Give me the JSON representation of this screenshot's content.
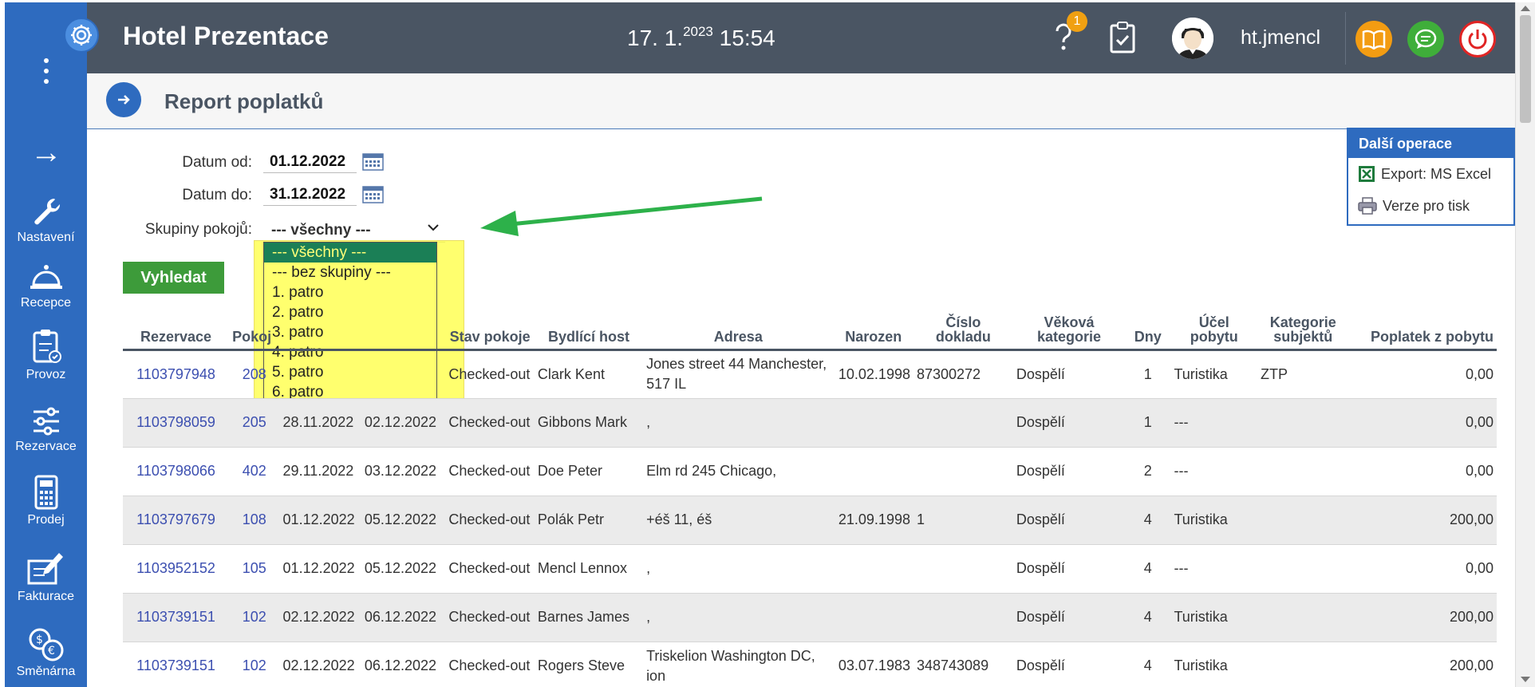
{
  "header": {
    "app_title": "Hotel Prezentace",
    "clock_day": "17. 1.",
    "clock_year": "2023",
    "clock_time": "15:54",
    "help_badge": "1",
    "username": "ht.jmencl"
  },
  "sidebar": {
    "items": [
      {
        "label": "Nastavení",
        "icon": "wrench-icon"
      },
      {
        "label": "Recepce",
        "icon": "bell-icon"
      },
      {
        "label": "Provoz",
        "icon": "clipboard-icon"
      },
      {
        "label": "Rezervace",
        "icon": "sliders-icon"
      },
      {
        "label": "Prodej",
        "icon": "calculator-icon"
      },
      {
        "label": "Fakturace",
        "icon": "invoice-icon"
      },
      {
        "label": "Směnárna",
        "icon": "exchange-icon"
      }
    ]
  },
  "page": {
    "title": "Report poplatků"
  },
  "filters": {
    "date_from_label": "Datum od:",
    "date_from": "01.12.2022",
    "date_to_label": "Datum do:",
    "date_to": "31.12.2022",
    "groups_label": "Skupiny pokojů:",
    "groups_selected": "--- všechny ---",
    "groups_options": [
      "--- všechny ---",
      "--- bez skupiny ---",
      "1. patro",
      "2. patro",
      "3. patro",
      "4. patro",
      "5. patro",
      "6. patro"
    ],
    "search_label": "Vyhledat"
  },
  "ops": {
    "title": "Další operace",
    "export_label": "Export: MS Excel",
    "print_label": "Verze pro tisk"
  },
  "table": {
    "headers": {
      "rez": "Rezervace",
      "pokoj": "Pokoj",
      "od": "",
      "do": "",
      "stav": "Stav pokoje",
      "host": "Bydlící host",
      "adresa": "Adresa",
      "narozen": "Narozen",
      "doklad": "Číslo dokladu",
      "vek": "Věková kategorie",
      "dny": "Dny",
      "ucel": "Účel pobytu",
      "kat": "Kategorie subjektů",
      "poplatek": "Poplatek z pobytu"
    },
    "rows": [
      {
        "rez": "1103797948",
        "pokoj": "208",
        "od": "",
        "do": "",
        "stav": "Checked-out",
        "host": "Clark Kent",
        "adresa": "Jones street 44 Manchester, 517 IL",
        "narozen": "10.02.1998",
        "doklad": "87300272",
        "vek": "Dospělí",
        "dny": "1",
        "ucel": "Turistika",
        "kat": "ZTP",
        "poplatek": "0,00"
      },
      {
        "rez": "1103798059",
        "pokoj": "205",
        "od": "28.11.2022",
        "do": "02.12.2022",
        "stav": "Checked-out",
        "host": "Gibbons Mark",
        "adresa": ",",
        "narozen": "",
        "doklad": "",
        "vek": "Dospělí",
        "dny": "1",
        "ucel": "---",
        "kat": "",
        "poplatek": "0,00"
      },
      {
        "rez": "1103798066",
        "pokoj": "402",
        "od": "29.11.2022",
        "do": "03.12.2022",
        "stav": "Checked-out",
        "host": "Doe Peter",
        "adresa": "Elm rd 245 Chicago,",
        "narozen": "",
        "doklad": "",
        "vek": "Dospělí",
        "dny": "2",
        "ucel": "---",
        "kat": "",
        "poplatek": "0,00"
      },
      {
        "rez": "1103797679",
        "pokoj": "108",
        "od": "01.12.2022",
        "do": "05.12.2022",
        "stav": "Checked-out",
        "host": "Polák Petr",
        "adresa": "+éš 11, éš",
        "narozen": "21.09.1998",
        "doklad": "1",
        "vek": "Dospělí",
        "dny": "4",
        "ucel": "Turistika",
        "kat": "",
        "poplatek": "200,00"
      },
      {
        "rez": "1103952152",
        "pokoj": "105",
        "od": "01.12.2022",
        "do": "05.12.2022",
        "stav": "Checked-out",
        "host": "Mencl Lennox",
        "adresa": ",",
        "narozen": "",
        "doklad": "",
        "vek": "Dospělí",
        "dny": "4",
        "ucel": "---",
        "kat": "",
        "poplatek": "0,00"
      },
      {
        "rez": "1103739151",
        "pokoj": "102",
        "od": "02.12.2022",
        "do": "06.12.2022",
        "stav": "Checked-out",
        "host": "Barnes James",
        "adresa": ",",
        "narozen": "",
        "doklad": "",
        "vek": "Dospělí",
        "dny": "4",
        "ucel": "Turistika",
        "kat": "",
        "poplatek": "200,00"
      },
      {
        "rez": "1103739151",
        "pokoj": "102",
        "od": "02.12.2022",
        "do": "06.12.2022",
        "stav": "Checked-out",
        "host": "Rogers Steve",
        "adresa": "Triskelion Washington DC, ion",
        "narozen": "03.07.1983",
        "doklad": "348743089",
        "vek": "Dospělí",
        "dny": "4",
        "ucel": "Turistika",
        "kat": "",
        "poplatek": "200,00"
      }
    ]
  },
  "colors": {
    "sidebar": "#2e6bbf",
    "topbar": "#4a5563",
    "accent_green": "#3d9b3a",
    "dropdown_highlight": "#ffff55"
  }
}
